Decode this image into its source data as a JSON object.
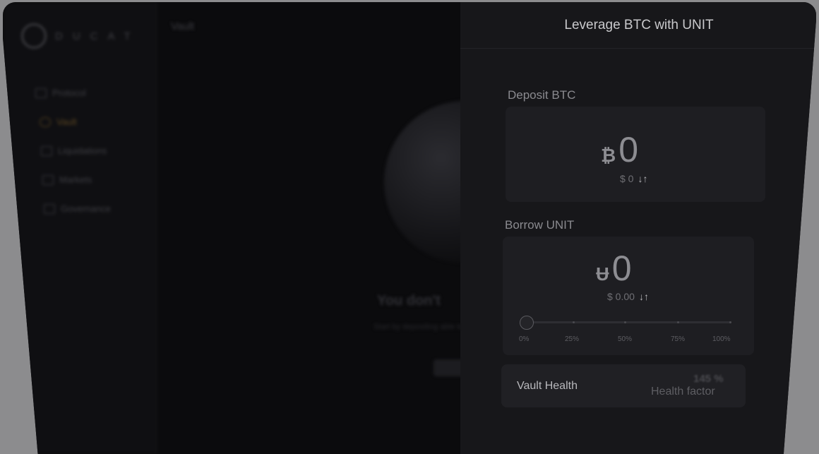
{
  "sidebar": {
    "logo_text": "DUCAT",
    "items": [
      {
        "label": "Protocol",
        "icon": "protocol-icon"
      },
      {
        "label": "Vault",
        "icon": "vault-icon",
        "active": true
      },
      {
        "label": "Liquidations",
        "icon": "liquidations-icon"
      },
      {
        "label": "Markets",
        "icon": "markets-icon"
      },
      {
        "label": "Governance",
        "icon": "governance-icon"
      }
    ]
  },
  "main": {
    "title": "Vault",
    "empty_title": "You don't",
    "empty_subtitle": "Start by depositing able to borr"
  },
  "drawer": {
    "title": "Leverage BTC with UNIT",
    "deposit": {
      "label": "Deposit BTC",
      "symbol": "₿",
      "amount": "0",
      "usd": "$ 0",
      "swap_icon": "swap-vertical-icon"
    },
    "borrow": {
      "label": "Borrow UNIT",
      "symbol": "Ʉ",
      "amount": "0",
      "usd": "$ 0.00",
      "swap_icon": "swap-vertical-icon",
      "slider": {
        "value_percent": 0,
        "ticks": [
          "0%",
          "25%",
          "50%",
          "75%",
          "100%"
        ]
      }
    },
    "health": {
      "title": "Vault Health",
      "percent": "145 %",
      "subtitle": "Health factor"
    }
  },
  "colors": {
    "backdrop": "#8c8c8e",
    "drawer_bg": "#17171a",
    "card_bg": "#1e1e22",
    "accent": "#5a4520"
  }
}
